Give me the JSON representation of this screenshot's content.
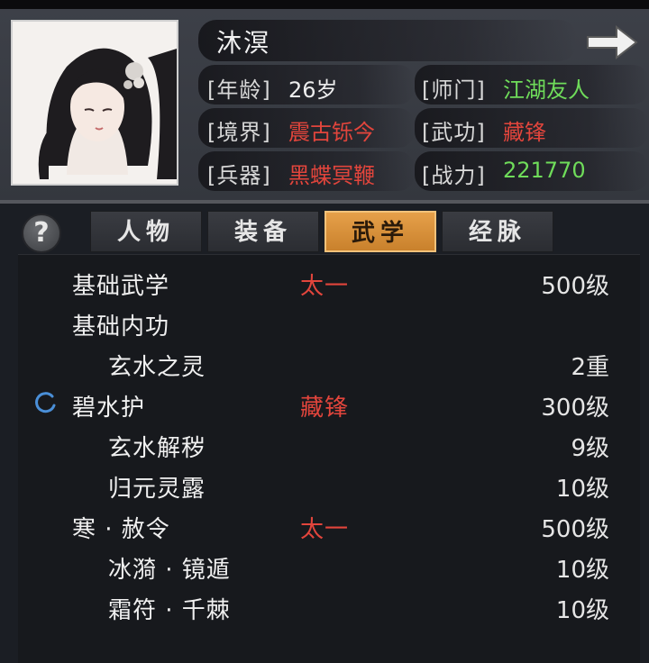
{
  "character": {
    "name": "沐溟",
    "fields": {
      "age_label": "[年龄]",
      "age_value": "26岁",
      "sect_label": "[师门]",
      "sect_value": "江湖友人",
      "realm_label": "[境界]",
      "realm_value": "震古铄今",
      "martial_label": "[武功]",
      "martial_value": "藏锋",
      "weapon_label": "[兵器]",
      "weapon_value": "黑蝶冥鞭",
      "power_label": "[战力]",
      "power_value": "221770"
    }
  },
  "tabs": [
    {
      "label": "人物",
      "active": false
    },
    {
      "label": "装备",
      "active": false
    },
    {
      "label": "武学",
      "active": true
    },
    {
      "label": "经脉",
      "active": false
    }
  ],
  "help_label": "?",
  "skills": [
    {
      "name": "基础武学",
      "tag": "太一",
      "level": "500级",
      "indent": false,
      "active": false
    },
    {
      "name": "基础内功",
      "tag": "",
      "level": "",
      "indent": false,
      "active": false
    },
    {
      "name": "玄水之灵",
      "tag": "",
      "level": "2重",
      "indent": true,
      "active": false
    },
    {
      "name": "碧水护",
      "tag": "藏锋",
      "level": "300级",
      "indent": false,
      "active": true
    },
    {
      "name": "玄水解秽",
      "tag": "",
      "level": "9级",
      "indent": true,
      "active": false
    },
    {
      "name": "归元灵露",
      "tag": "",
      "level": "10级",
      "indent": true,
      "active": false
    },
    {
      "name": "寒 · 赦令",
      "tag": "太一",
      "level": "500级",
      "indent": false,
      "active": false
    },
    {
      "name": "冰漪 · 镜遁",
      "tag": "",
      "level": "10级",
      "indent": true,
      "active": false
    },
    {
      "name": "霜符 · 千棘",
      "tag": "",
      "level": "10级",
      "indent": true,
      "active": false
    }
  ],
  "colors": {
    "accent_tab": "#e6a04a",
    "red_text": "#e2453c",
    "green_text": "#6fdc5a"
  },
  "icons": {
    "next": "arrow-right-icon",
    "help": "question-icon",
    "active_skill": "spinner-icon"
  }
}
